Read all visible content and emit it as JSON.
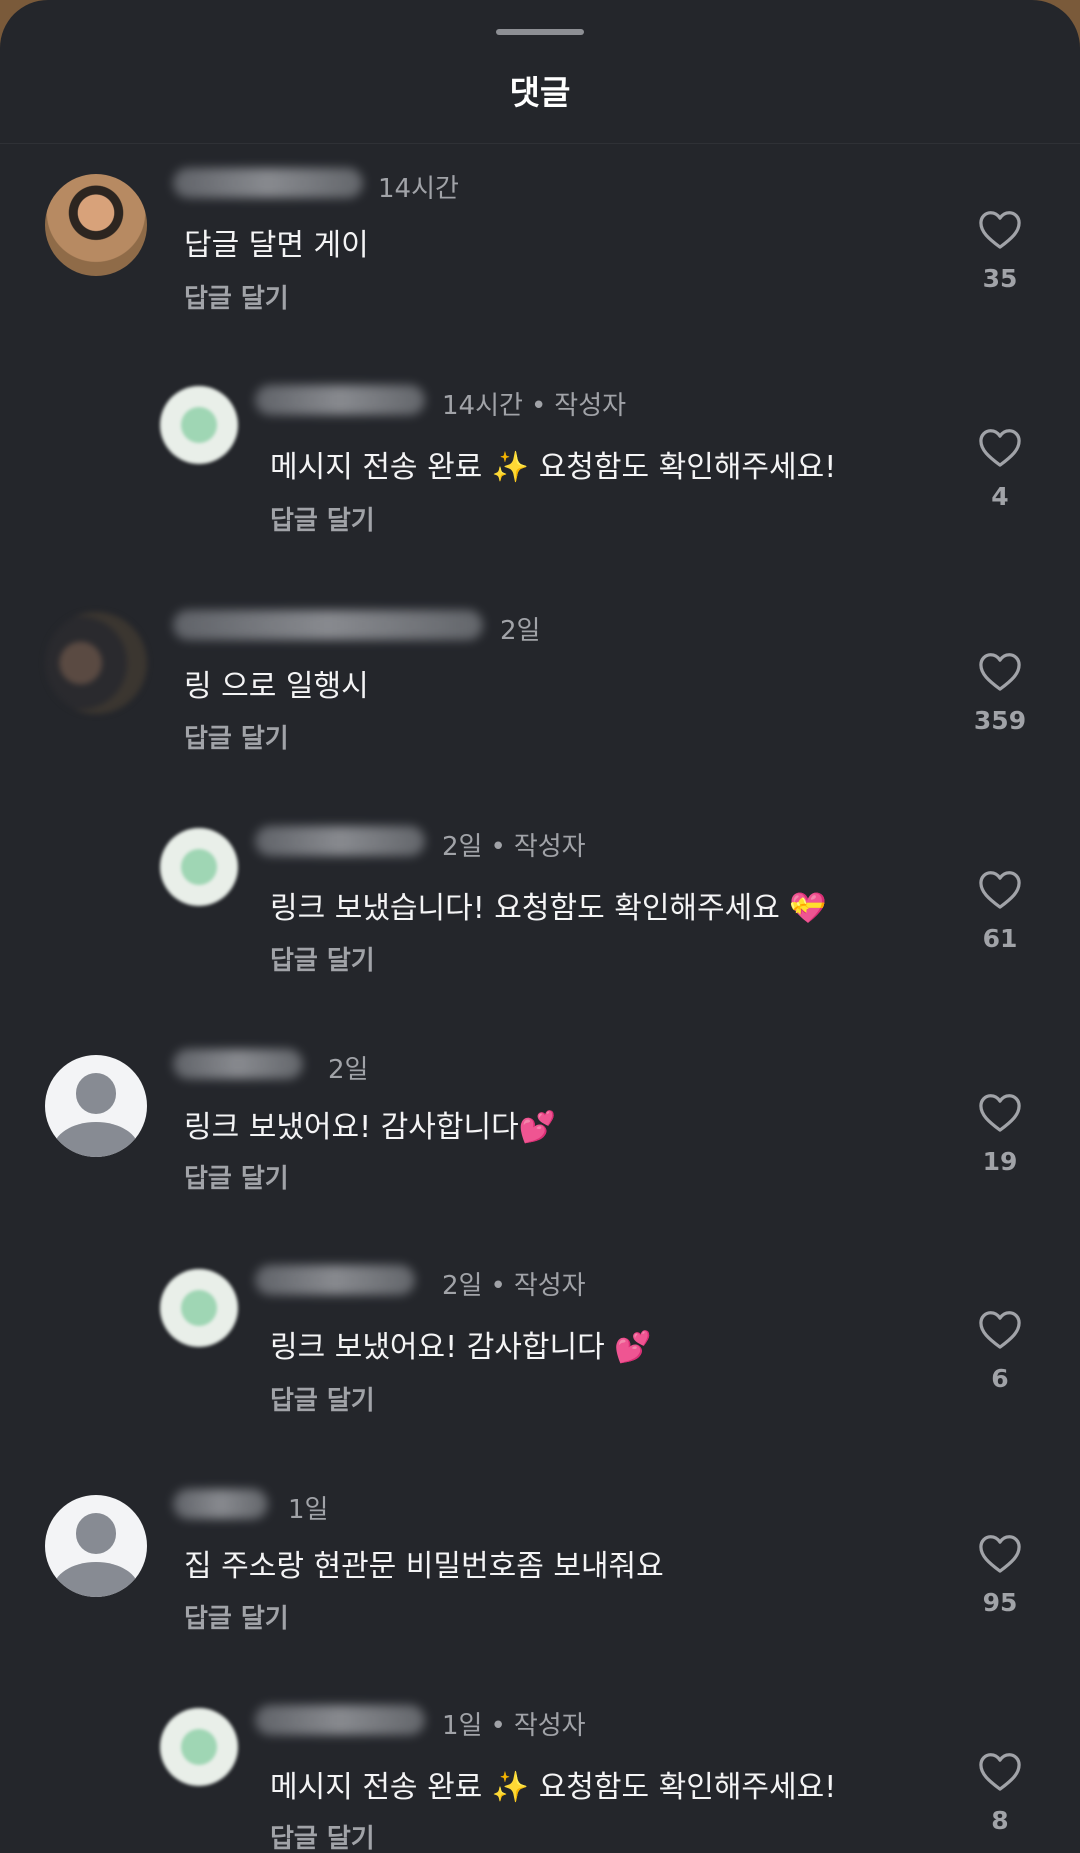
{
  "header": {
    "title": "댓글"
  },
  "reply_label": "답글 달기",
  "author_label": "작성자",
  "comments": [
    {
      "time": "14시간",
      "text": "답글 달면 게이",
      "likes": "35",
      "is_reply": false,
      "is_author": false,
      "avatar": "photo"
    },
    {
      "time": "14시간",
      "text": "메시지 전송 완료 ✨ 요청함도 확인해주세요!",
      "likes": "4",
      "is_reply": true,
      "is_author": true,
      "avatar": "author"
    },
    {
      "time": "2일",
      "text": "링 으로 일행시",
      "likes": "359",
      "is_reply": false,
      "is_author": false,
      "avatar": "photo"
    },
    {
      "time": "2일",
      "text": "링크 보냈습니다! 요청함도 확인해주세요 💝",
      "likes": "61",
      "is_reply": true,
      "is_author": true,
      "avatar": "author"
    },
    {
      "time": "2일",
      "text": "링크 보냈어요! 감사합니다💕",
      "likes": "19",
      "is_reply": false,
      "is_author": false,
      "avatar": "default"
    },
    {
      "time": "2일",
      "text": "링크 보냈어요! 감사합니다 💕",
      "likes": "6",
      "is_reply": true,
      "is_author": true,
      "avatar": "author"
    },
    {
      "time": "1일",
      "text": "집 주소랑 현관문 비밀번호좀 보내줘요",
      "likes": "95",
      "is_reply": false,
      "is_author": false,
      "avatar": "default"
    },
    {
      "time": "1일",
      "text": "메시지 전송 완료 ✨ 요청함도 확인해주세요!",
      "likes": "8",
      "is_reply": true,
      "is_author": true,
      "avatar": "author"
    }
  ],
  "colors": {
    "background": "#24262b",
    "text_primary": "#f4f4f5",
    "text_secondary": "#a1a3a8"
  }
}
